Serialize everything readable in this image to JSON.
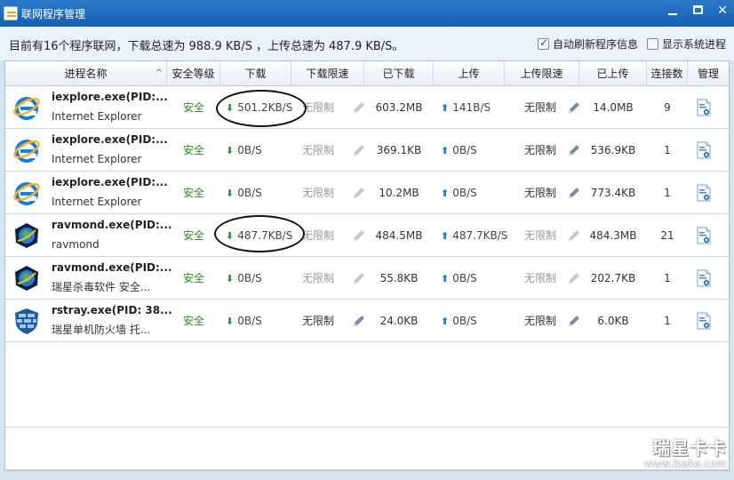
{
  "window": {
    "title": "联网程序管理",
    "min_icon": "minimize-icon",
    "max_icon": "maximize-icon",
    "close_glyph": "✕"
  },
  "summary": {
    "prefix": "目前有16个程序联网，下载总速为",
    "download_total": "988.9 KB/S",
    "middle": "，上传总速为",
    "upload_total": "487.9 KB/S。",
    "auto_refresh_label": "自动刷新程序信息",
    "auto_refresh_checked": true,
    "show_system_label": "显示系统进程",
    "show_system_checked": false
  },
  "columns": [
    "进程名称",
    "安全等级",
    "下载",
    "下载限速",
    "已下载",
    "上传",
    "上传限速",
    "已上传",
    "连接数",
    "管理"
  ],
  "sort_arrow": "^",
  "rows": [
    {
      "icon": "internet-explorer-icon",
      "name": "iexplore.exe(PID:...",
      "desc": "Internet Explorer",
      "safety": "安全",
      "download": "501.2KB/S",
      "dl_limit": "无限制",
      "dl_limit_active": false,
      "downloaded": "603.2MB",
      "upload": "141B/S",
      "ul_limit": "无限制",
      "ul_limit_active": true,
      "uploaded": "14.0MB",
      "connections": "9"
    },
    {
      "icon": "internet-explorer-icon",
      "name": "iexplore.exe(PID:...",
      "desc": "Internet Explorer",
      "safety": "安全",
      "download": "0B/S",
      "dl_limit": "无限制",
      "dl_limit_active": false,
      "downloaded": "369.1KB",
      "upload": "0B/S",
      "ul_limit": "无限制",
      "ul_limit_active": true,
      "uploaded": "536.9KB",
      "connections": "1"
    },
    {
      "icon": "internet-explorer-icon",
      "name": "iexplore.exe(PID:...",
      "desc": "Internet Explorer",
      "safety": "安全",
      "download": "0B/S",
      "dl_limit": "无限制",
      "dl_limit_active": false,
      "downloaded": "10.2MB",
      "upload": "0B/S",
      "ul_limit": "无限制",
      "ul_limit_active": true,
      "uploaded": "773.4KB",
      "connections": "1"
    },
    {
      "icon": "ravmond-icon",
      "name": "ravmond.exe(PID:...",
      "desc": "ravmond",
      "safety": "安全",
      "download": "487.7KB/S",
      "dl_limit": "无限制",
      "dl_limit_active": false,
      "downloaded": "484.5MB",
      "upload": "487.7KB/S",
      "ul_limit": "无限制",
      "ul_limit_active": false,
      "uploaded": "484.3MB",
      "connections": "21"
    },
    {
      "icon": "ravmond-icon",
      "name": "ravmond.exe(PID:...",
      "desc": "瑞星杀毒软件 安全...",
      "safety": "安全",
      "download": "0B/S",
      "dl_limit": "无限制",
      "dl_limit_active": false,
      "downloaded": "55.8KB",
      "upload": "0B/S",
      "ul_limit": "无限制",
      "ul_limit_active": false,
      "uploaded": "202.7KB",
      "connections": "1"
    },
    {
      "icon": "firewall-icon",
      "name": "rstray.exe(PID: 38...",
      "desc": "瑞星单机防火墙 托...",
      "safety": "安全",
      "download": "0B/S",
      "dl_limit": "无限制",
      "dl_limit_active": true,
      "downloaded": "24.0KB",
      "upload": "0B/S",
      "ul_limit": "无限制",
      "ul_limit_active": true,
      "uploaded": "6.0KB",
      "connections": "1"
    }
  ],
  "watermark": {
    "big": "瑞星卡卡",
    "small": "www.ikaka.com"
  },
  "colors": {
    "titlebar": "#1862b0",
    "safe": "#2a8a2a",
    "download_arrow": "#2e9b2e",
    "upload_arrow": "#2a78c8"
  }
}
